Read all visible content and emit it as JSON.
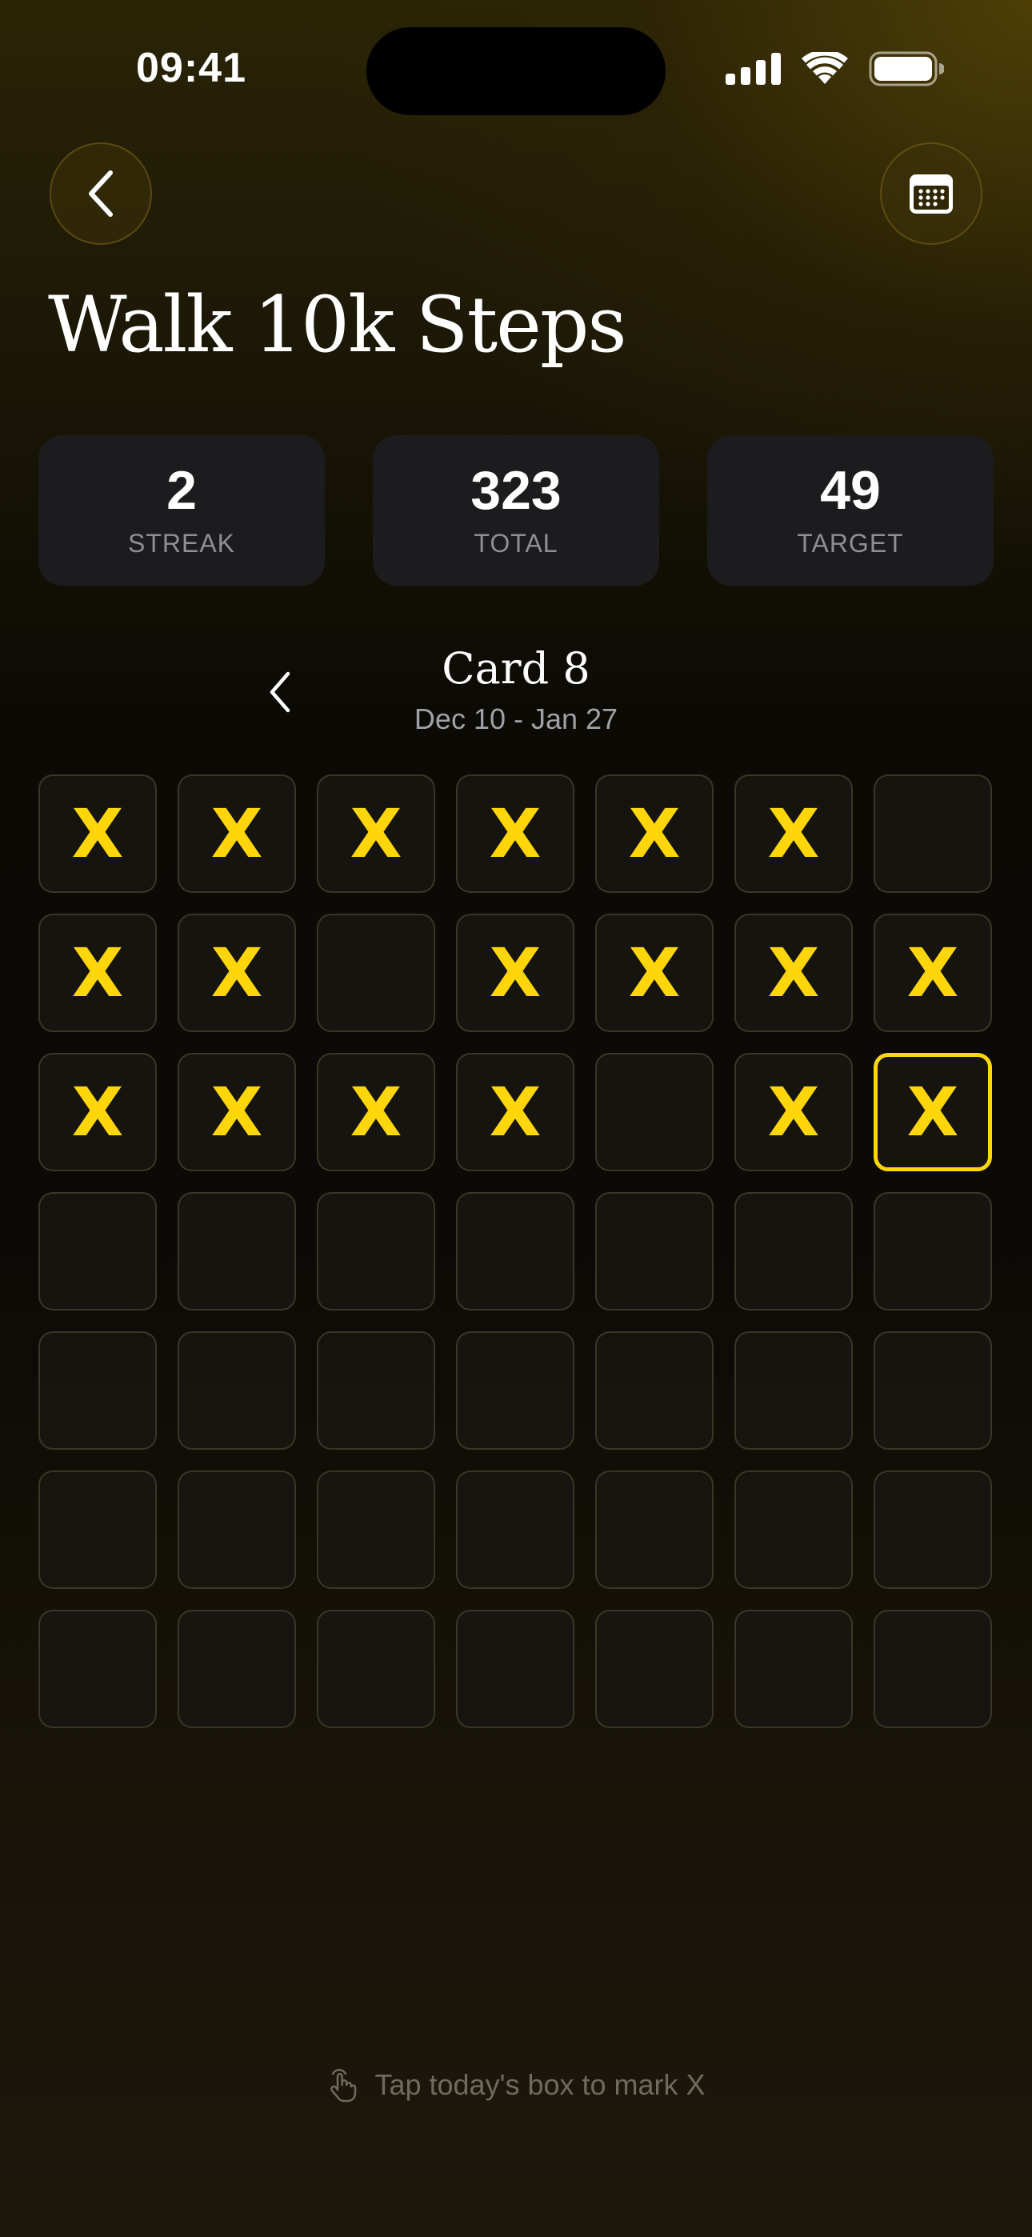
{
  "status_bar": {
    "time": "09:41"
  },
  "header": {
    "back_icon": "chevron-left-icon",
    "calendar_icon": "calendar-icon"
  },
  "habit": {
    "title": "Walk 10k Steps"
  },
  "stats": [
    {
      "value": "2",
      "label": "STREAK"
    },
    {
      "value": "323",
      "label": "TOTAL"
    },
    {
      "value": "49",
      "label": "TARGET"
    }
  ],
  "card": {
    "title": "Card 8",
    "date_range": "Dec 10 - Jan 27",
    "prev_icon": "chevron-left-icon"
  },
  "grid": {
    "mark": "X",
    "today_index": 20,
    "cells": [
      true,
      true,
      true,
      true,
      true,
      true,
      false,
      true,
      true,
      false,
      true,
      true,
      true,
      true,
      true,
      true,
      true,
      true,
      false,
      true,
      true,
      false,
      false,
      false,
      false,
      false,
      false,
      false,
      false,
      false,
      false,
      false,
      false,
      false,
      false,
      false,
      false,
      false,
      false,
      false,
      false,
      false,
      false,
      false,
      false,
      false,
      false,
      false,
      false
    ]
  },
  "hint": {
    "text": "Tap today's box to mark X",
    "icon": "tap-hand-icon"
  },
  "colors": {
    "accent": "#ffd60a",
    "card_bg": "#1c1c1e",
    "muted_text": "#8e8e93"
  }
}
